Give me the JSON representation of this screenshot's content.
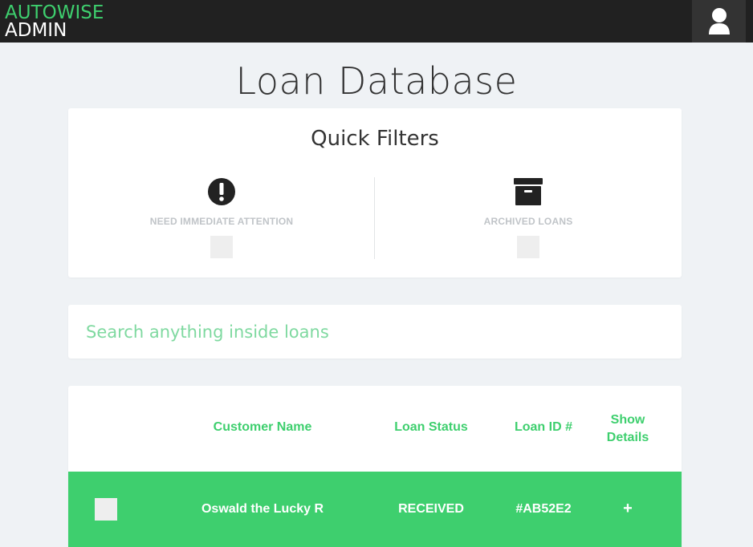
{
  "header": {
    "brand_line1": "AUTOWISE",
    "brand_line2": "ADMIN",
    "user_icon": "user-icon"
  },
  "page": {
    "title": "Loan Database"
  },
  "quick_filters": {
    "title": "Quick Filters",
    "items": [
      {
        "label": "NEED IMMEDIATE ATTENTION",
        "icon": "alert-circle-icon",
        "checked": false
      },
      {
        "label": "ARCHIVED LOANS",
        "icon": "archive-box-icon",
        "checked": false
      }
    ]
  },
  "search": {
    "placeholder": "Search anything inside loans",
    "value": ""
  },
  "table": {
    "columns": {
      "customer_name": "Customer Name",
      "loan_status": "Loan Status",
      "loan_id": "Loan ID #",
      "show_details": "Show Details"
    },
    "rows": [
      {
        "selected": false,
        "customer_name": "Oswald the Lucky R",
        "loan_status": "RECEIVED",
        "loan_id": "#AB52E2",
        "details_toggle": "+"
      }
    ]
  },
  "colors": {
    "accent": "#3ecf6e",
    "topbar": "#212121",
    "background": "#eff2f5"
  }
}
